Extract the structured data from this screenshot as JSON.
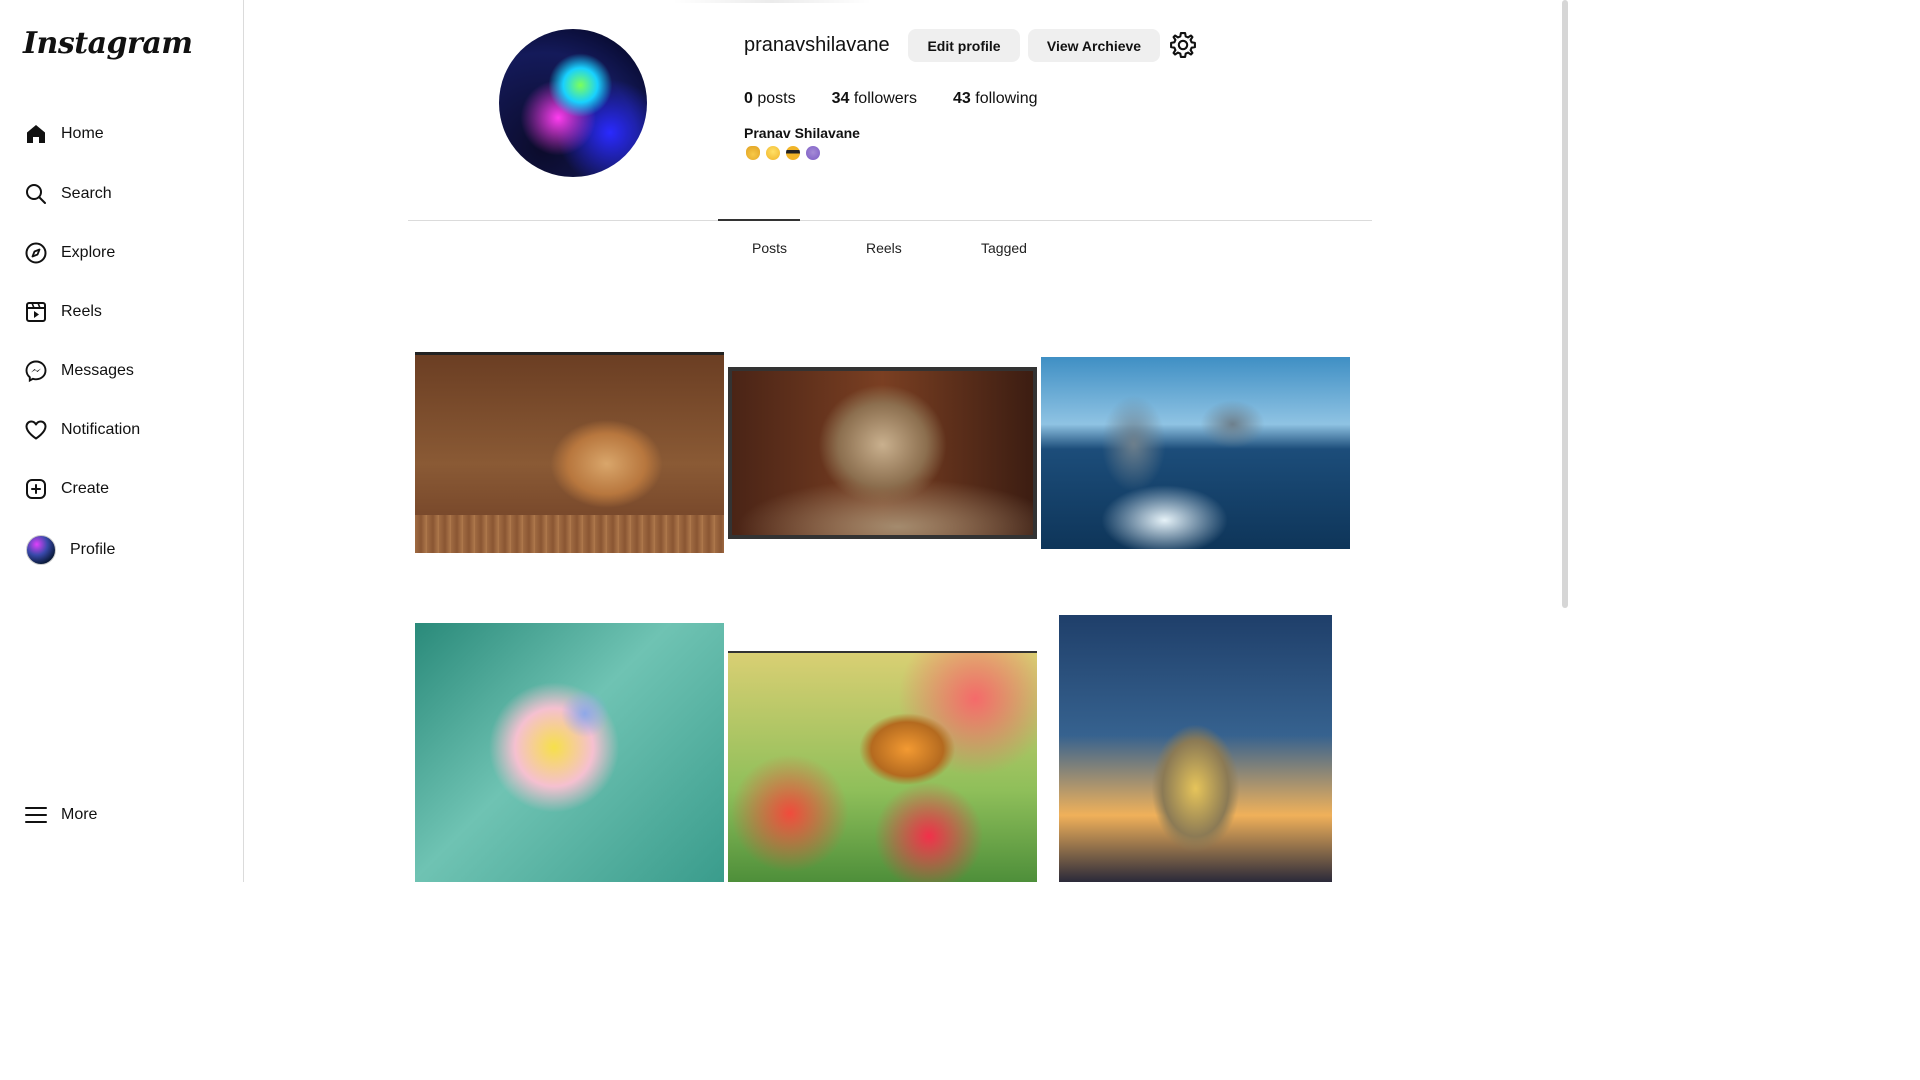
{
  "sidebar": {
    "logo": "Instagram",
    "items": [
      {
        "label": "Home",
        "icon": "home-icon"
      },
      {
        "label": "Search",
        "icon": "search-icon"
      },
      {
        "label": "Explore",
        "icon": "compass-icon"
      },
      {
        "label": "Reels",
        "icon": "reels-icon"
      },
      {
        "label": "Messages",
        "icon": "messenger-icon"
      },
      {
        "label": "Notification",
        "icon": "heart-icon"
      },
      {
        "label": "Create",
        "icon": "plus-square-icon"
      },
      {
        "label": "Profile",
        "icon": "avatar"
      }
    ],
    "more_label": "More"
  },
  "profile": {
    "username": "pranavshilavane",
    "edit_label": "Edit profile",
    "archive_label": "View Archieve",
    "stats": {
      "posts_count": "0",
      "posts_label": "posts",
      "followers_count": "34",
      "followers_label": "followers",
      "following_count": "43",
      "following_label": "following"
    },
    "full_name": "Pranav Shilavane",
    "bio_emojis": [
      "victory-hand",
      "grinning-face",
      "sunglasses-face",
      "smiling-imp"
    ]
  },
  "tabs": [
    {
      "label": "Posts",
      "active": true
    },
    {
      "label": "Reels",
      "active": false
    },
    {
      "label": "Tagged",
      "active": false
    }
  ],
  "posts": [
    {
      "subject": "puppy"
    },
    {
      "subject": "cat"
    },
    {
      "subject": "dolphins"
    },
    {
      "subject": "flower-butterfly"
    },
    {
      "subject": "butterfly-flowers"
    },
    {
      "subject": "jar-of-lights"
    }
  ]
}
